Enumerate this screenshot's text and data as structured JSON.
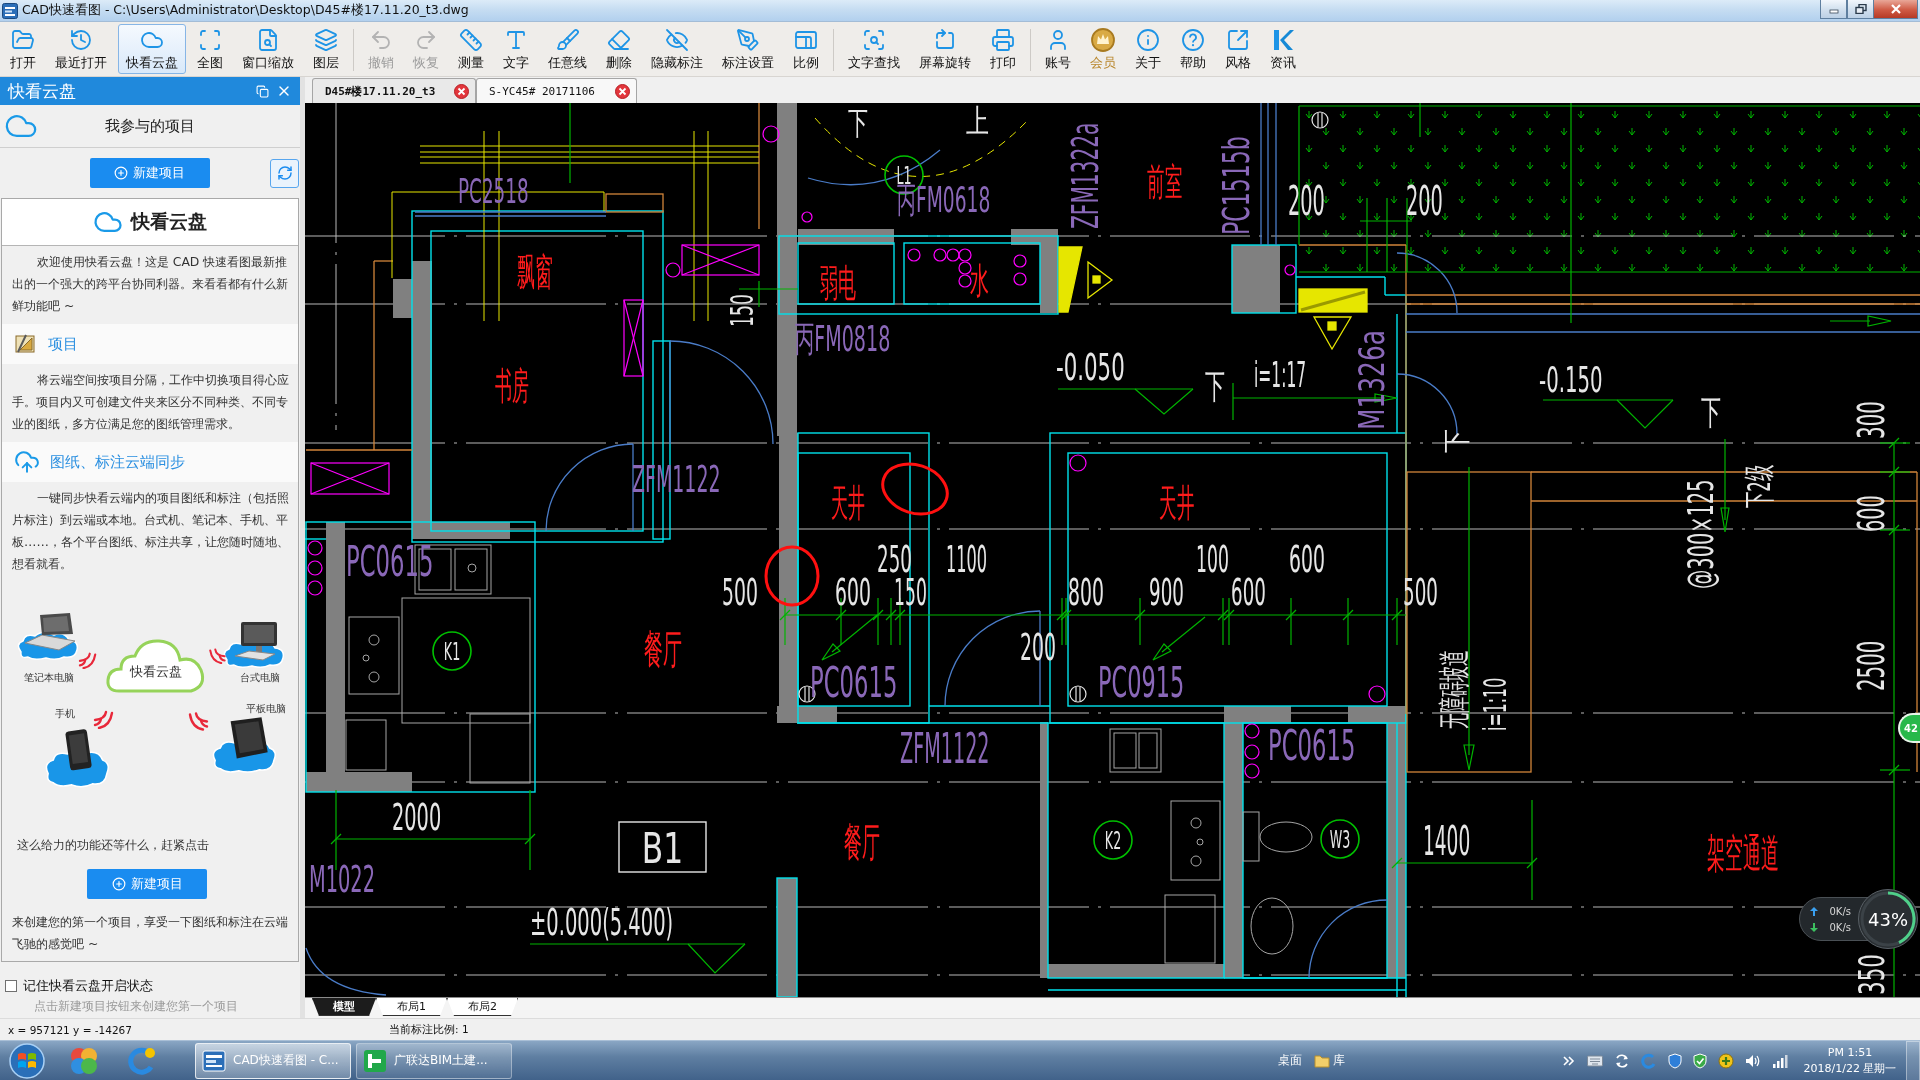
{
  "window": {
    "title": "CAD快速看图 - C:\\Users\\Administrator\\Desktop\\D45#楼17.11.20_t3.dwg"
  },
  "toolbar": {
    "groups": [
      {
        "items": [
          {
            "label": "打开",
            "selected": false,
            "disabled": false,
            "kind": "normal"
          },
          {
            "label": "最近打开",
            "selected": false,
            "disabled": false,
            "kind": "normal"
          },
          {
            "label": "快看云盘",
            "selected": true,
            "disabled": false,
            "kind": "normal"
          },
          {
            "label": "全图",
            "selected": false,
            "disabled": false,
            "kind": "normal"
          },
          {
            "label": "窗口缩放",
            "selected": false,
            "disabled": false,
            "kind": "normal"
          },
          {
            "label": "图层",
            "selected": false,
            "disabled": false,
            "kind": "normal"
          }
        ]
      },
      {
        "items": [
          {
            "label": "撤销",
            "selected": false,
            "disabled": true,
            "kind": "normal"
          },
          {
            "label": "恢复",
            "selected": false,
            "disabled": true,
            "kind": "normal"
          },
          {
            "label": "测量",
            "selected": false,
            "disabled": false,
            "kind": "normal"
          },
          {
            "label": "文字",
            "selected": false,
            "disabled": false,
            "kind": "normal"
          },
          {
            "label": "任意线",
            "selected": false,
            "disabled": false,
            "kind": "normal"
          },
          {
            "label": "删除",
            "selected": false,
            "disabled": false,
            "kind": "normal"
          },
          {
            "label": "隐藏标注",
            "selected": false,
            "disabled": false,
            "kind": "normal"
          },
          {
            "label": "标注设置",
            "selected": false,
            "disabled": false,
            "kind": "normal"
          },
          {
            "label": "比例",
            "selected": false,
            "disabled": false,
            "kind": "normal"
          }
        ]
      },
      {
        "items": [
          {
            "label": "文字查找",
            "selected": false,
            "disabled": false,
            "kind": "normal"
          },
          {
            "label": "屏幕旋转",
            "selected": false,
            "disabled": false,
            "kind": "normal"
          },
          {
            "label": "打印",
            "selected": false,
            "disabled": false,
            "kind": "normal"
          }
        ]
      },
      {
        "items": [
          {
            "label": "账号",
            "selected": false,
            "disabled": false,
            "kind": "normal"
          },
          {
            "label": "会员",
            "selected": false,
            "disabled": false,
            "kind": "premium"
          },
          {
            "label": "关于",
            "selected": false,
            "disabled": false,
            "kind": "normal"
          },
          {
            "label": "帮助",
            "selected": false,
            "disabled": false,
            "kind": "normal"
          },
          {
            "label": "风格",
            "selected": false,
            "disabled": false,
            "kind": "normal"
          },
          {
            "label": "资讯",
            "selected": false,
            "disabled": false,
            "kind": "normal"
          }
        ]
      }
    ]
  },
  "side_panel": {
    "title": "快看云盘",
    "projects_label": "我参与的项目",
    "new_project_button": "新建项目",
    "card": {
      "title": "快看云盘",
      "intro": "欢迎使用快看云盘！这是 CAD 快速看图最新推出的一个强大的跨平台协同利器。来看看都有什么新鲜功能吧 ~",
      "sections": [
        {
          "heading": "项目",
          "text": "将云端空间按项目分隔，工作中切换项目得心应手。项目内又可创建文件夹来区分不同种类、不同专业的图纸，多方位满足您的图纸管理需求。"
        },
        {
          "heading": "图纸、标注云端同步",
          "text": "一键同步快看云端内的项目图纸和标注（包括照片标注）到云端或本地。台式机、笔记本、手机、平板……，各个平台图纸、标注共享，让您随时随地、想看就看。"
        }
      ],
      "devices": [
        {
          "kind": "laptop",
          "label": "笔记本电脑"
        },
        {
          "kind": "cloud",
          "label": "快看云盘"
        },
        {
          "kind": "desktop",
          "label": "台式电脑"
        },
        {
          "kind": "phone",
          "label": "手机"
        },
        {
          "kind": "tablet",
          "label": "平板电脑"
        }
      ],
      "prompt": "这么给力的功能还等什么，赶紧点击",
      "button": "新建项目",
      "closing": "来创建您的第一个项目，享受一下图纸和标注在云端飞驰的感觉吧 ~"
    },
    "remember": {
      "label": "记住快看云盘开启状态",
      "checked": false
    },
    "hint": "点击新建项目按钮来创建您第一个项目"
  },
  "document_tabs": [
    {
      "label": "D45#楼17.11.20_t3",
      "selected": true
    },
    {
      "label": "S-YC45# 20171106",
      "selected": false
    }
  ],
  "drawing": {
    "labels": [
      {
        "text": "下",
        "kind": "note"
      },
      {
        "text": "上",
        "kind": "note"
      },
      {
        "text": "PC2518",
        "kind": "code"
      },
      {
        "text": "L1",
        "kind": "tag"
      },
      {
        "text": "丙FM0618",
        "kind": "code"
      },
      {
        "text": "ZFM1322a",
        "kind": "code"
      },
      {
        "text": "前室",
        "kind": "room"
      },
      {
        "text": "PC1515b",
        "kind": "code"
      },
      {
        "text": "200",
        "kind": "dimension"
      },
      {
        "text": "200",
        "kind": "dimension"
      },
      {
        "text": "飘窗",
        "kind": "room"
      },
      {
        "text": "弱电",
        "kind": "room"
      },
      {
        "text": "水",
        "kind": "room"
      },
      {
        "text": "150",
        "kind": "dimension"
      },
      {
        "text": "丙FM0818",
        "kind": "code"
      },
      {
        "text": "-0.050",
        "kind": "level"
      },
      {
        "text": "下",
        "kind": "note"
      },
      {
        "text": "i=1:17",
        "kind": "note"
      },
      {
        "text": "M1326a",
        "kind": "code"
      },
      {
        "text": "-0.150",
        "kind": "level"
      },
      {
        "text": "下",
        "kind": "note"
      },
      {
        "text": "下",
        "kind": "note"
      },
      {
        "text": "书房",
        "kind": "room"
      },
      {
        "text": "300",
        "kind": "dimension"
      },
      {
        "text": "ZFM1122",
        "kind": "code"
      },
      {
        "text": "下2级",
        "kind": "note"
      },
      {
        "text": "天井",
        "kind": "room"
      },
      {
        "text": "天井",
        "kind": "room"
      },
      {
        "text": "600",
        "kind": "dimension"
      },
      {
        "text": "PC0615",
        "kind": "code"
      },
      {
        "text": "250",
        "kind": "dimension"
      },
      {
        "text": "1100",
        "kind": "dimension"
      },
      {
        "text": "100",
        "kind": "dimension"
      },
      {
        "text": "600",
        "kind": "dimension"
      },
      {
        "text": "@300×125",
        "kind": "note"
      },
      {
        "text": "500",
        "kind": "dimension"
      },
      {
        "text": "600",
        "kind": "dimension"
      },
      {
        "text": "150",
        "kind": "dimension"
      },
      {
        "text": "800",
        "kind": "dimension"
      },
      {
        "text": "900",
        "kind": "dimension"
      },
      {
        "text": "600",
        "kind": "dimension"
      },
      {
        "text": "500",
        "kind": "dimension"
      },
      {
        "text": "K1",
        "kind": "tag"
      },
      {
        "text": "餐厅",
        "kind": "room"
      },
      {
        "text": "200",
        "kind": "dimension"
      },
      {
        "text": "2500",
        "kind": "dimension"
      },
      {
        "text": "PC0615",
        "kind": "code"
      },
      {
        "text": "PC0915",
        "kind": "code"
      },
      {
        "text": "无障碍坡道",
        "kind": "note"
      },
      {
        "text": "i=1:10",
        "kind": "note"
      },
      {
        "text": "PC0615",
        "kind": "code"
      },
      {
        "text": "ZFM1122",
        "kind": "code"
      },
      {
        "text": "2000",
        "kind": "dimension"
      },
      {
        "text": "B1",
        "kind": "box"
      },
      {
        "text": "餐厅",
        "kind": "room"
      },
      {
        "text": "K2",
        "kind": "tag"
      },
      {
        "text": "W3",
        "kind": "tag"
      },
      {
        "text": "1400",
        "kind": "dimension"
      },
      {
        "text": "架空通道",
        "kind": "room"
      },
      {
        "text": "M1022",
        "kind": "code"
      },
      {
        "text": "±0.000(5.400)",
        "kind": "level"
      },
      {
        "text": "350",
        "kind": "dimension"
      }
    ]
  },
  "network_widget": {
    "upload": "0K/s",
    "download": "0K/s",
    "usage": "43%",
    "level": 0.43,
    "badge": "42"
  },
  "layout_tabs": [
    {
      "label": "模型",
      "selected": true
    },
    {
      "label": "布局1",
      "selected": false
    },
    {
      "label": "布局2",
      "selected": false
    }
  ],
  "status_bar": {
    "coordinates": "x = 957121 y = -14267",
    "scale": "当前标注比例: 1"
  },
  "taskbar": {
    "windows": [
      {
        "label": "CAD快速看图 - C...",
        "selected": true
      },
      {
        "label": "广联达BIM土建...",
        "selected": false
      }
    ],
    "toolbars": [
      "桌面",
      "库"
    ],
    "time": "PM 1:51",
    "date": "2018/1/22 星期一"
  }
}
